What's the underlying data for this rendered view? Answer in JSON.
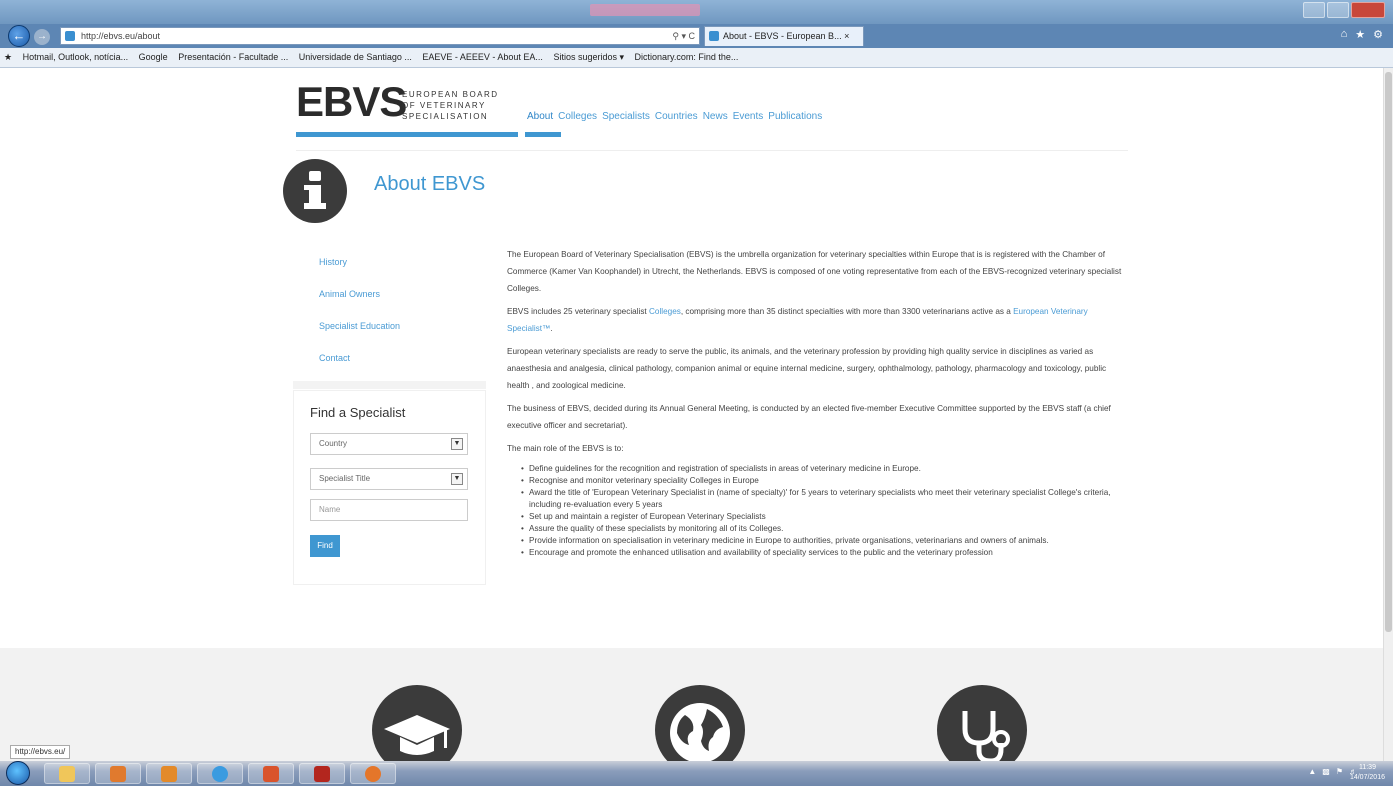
{
  "browser": {
    "address": "http://ebvs.eu/about",
    "tab_title": "About - EBVS - European B...",
    "status_url": "http://ebvs.eu/",
    "favorites": [
      "Hotmail, Outlook, notícia...",
      "Google",
      "Presentación - Facultade ...",
      "Universidade de Santiago ...",
      "EAEVE - AEEEV - About EA...",
      "Sitios sugeridos ▾",
      "Dictionary.com: Find the..."
    ]
  },
  "header": {
    "logo_text": "EBVS",
    "logo_line1": "EUROPEAN BOARD",
    "logo_line2": "OF VETERINARY",
    "logo_line3": "SPECIALISATION",
    "nav": [
      "About",
      "Colleges",
      "Specialists",
      "Countries",
      "News",
      "Events",
      "Publications"
    ]
  },
  "page_title": "About EBVS",
  "sidebar": {
    "items": [
      "History",
      "Animal Owners",
      "Specialist Education",
      "Contact"
    ]
  },
  "finder": {
    "title": "Find a Specialist",
    "country": "Country",
    "specialist_title": "Specialist Title",
    "name_placeholder": "Name",
    "find_label": "Find"
  },
  "content": {
    "p1": "The European Board of Veterinary Specialisation (EBVS) is the umbrella organization for veterinary specialties within Europe that is is registered with the Chamber of Commerce (Kamer Van Koophandel) in Utrecht, the Netherlands. EBVS is composed of one voting representative from each of the EBVS-recognized veterinary specialist Colleges.",
    "p2_pre": "EBVS includes 25 veterinary specialist ",
    "p2_link1": "Colleges",
    "p2_mid": ", comprising more than 35 distinct specialties with more than 3300 veterinarians active as a ",
    "p2_link2": "European Veterinary Specialist™",
    "p2_post": ".",
    "p3": "European veterinary specialists are ready to serve the public, its animals, and the veterinary profession by providing high quality service in disciplines as varied as anaesthesia and analgesia, clinical pathology, companion animal or equine internal medicine, surgery, ophthalmology, pathology, pharmacology and toxicology, public health , and zoological medicine.",
    "p4": "The business of EBVS, decided during its Annual General Meeting, is conducted by an elected five-member Executive Committee supported by the EBVS staff (a chief executive officer and secretariat).",
    "p5": "The main role of the EBVS is to:",
    "roles": [
      "Define guidelines for the recognition and registration of specialists in areas of veterinary medicine in Europe.",
      "Recognise and monitor veterinary speciality Colleges in Europe",
      "Award the title of 'European Veterinary Specialist in (name of specialty)' for 5 years to veterinary specialists who meet their veterinary specialist College's criteria, including re-evaluation every 5 years",
      "Set up and maintain a register of European Veterinary Specialists",
      "Assure the quality of these specialists by monitoring all of its Colleges.",
      "Provide information on specialisation in veterinary medicine in Europe to authorities, private organisations, veterinarians and owners of animals.",
      "Encourage and promote the enhanced utilisation and availability of speciality services to the public and the veterinary profession"
    ]
  },
  "footer_icons": [
    "graduation-cap-icon",
    "globe-icon",
    "stethoscope-icon"
  ],
  "clock": {
    "time": "11:39",
    "date": "14/07/2016"
  },
  "colors": {
    "accent": "#3f97d1",
    "dark": "#3b3b3b"
  }
}
